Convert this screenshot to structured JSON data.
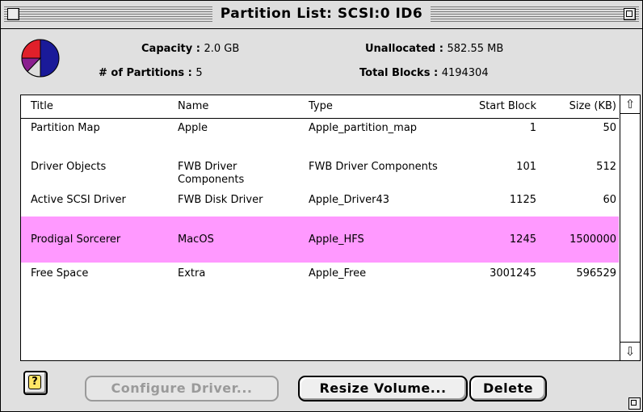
{
  "window": {
    "title": "Partition List: SCSI:0  ID6"
  },
  "info": {
    "capacity_label": "Capacity : ",
    "capacity_value": "2.0 GB",
    "partitions_label": "# of Partitions : ",
    "partitions_value": "5",
    "unallocated_label": "Unallocated : ",
    "unallocated_value": "582.55 MB",
    "total_blocks_label": "Total Blocks : ",
    "total_blocks_value": "4194304"
  },
  "pie": {
    "colors": [
      "#1a1a99",
      "#e0202a",
      "#8a1f8f",
      "#dddddd"
    ]
  },
  "table": {
    "headers": {
      "title": "Title",
      "name": "Name",
      "type": "Type",
      "start_block": "Start Block",
      "size": "Size (KB)"
    },
    "rows": [
      {
        "title": "Partition Map",
        "name": "Apple",
        "name2": "",
        "type": "Apple_partition_map",
        "start": "1",
        "size": "50"
      },
      {
        "title": "Driver Objects",
        "name": "FWB Driver",
        "name2": "Components",
        "type": "FWB Driver Components",
        "start": "101",
        "size": "512"
      },
      {
        "title": "Active SCSI Driver",
        "name": "FWB Disk Driver",
        "name2": "",
        "type": "Apple_Driver43",
        "start": "1125",
        "size": "60"
      },
      {
        "title": "Prodigal Sorcerer",
        "name": "MacOS",
        "name2": "",
        "type": "Apple_HFS",
        "start": "1245",
        "size": "1500000"
      },
      {
        "title": "Free Space",
        "name": "Extra",
        "name2": "",
        "type": "Apple_Free",
        "start": "3001245",
        "size": "596529"
      }
    ],
    "selected_color": "#ff99ff"
  },
  "buttons": {
    "help": "?",
    "configure": "Configure Driver...",
    "resize": "Resize Volume...",
    "delete": "Delete"
  },
  "icons": {
    "close": "close-box",
    "zoom": "zoom-box",
    "grow": "grow-box",
    "up": "⇧",
    "down": "⇩"
  }
}
